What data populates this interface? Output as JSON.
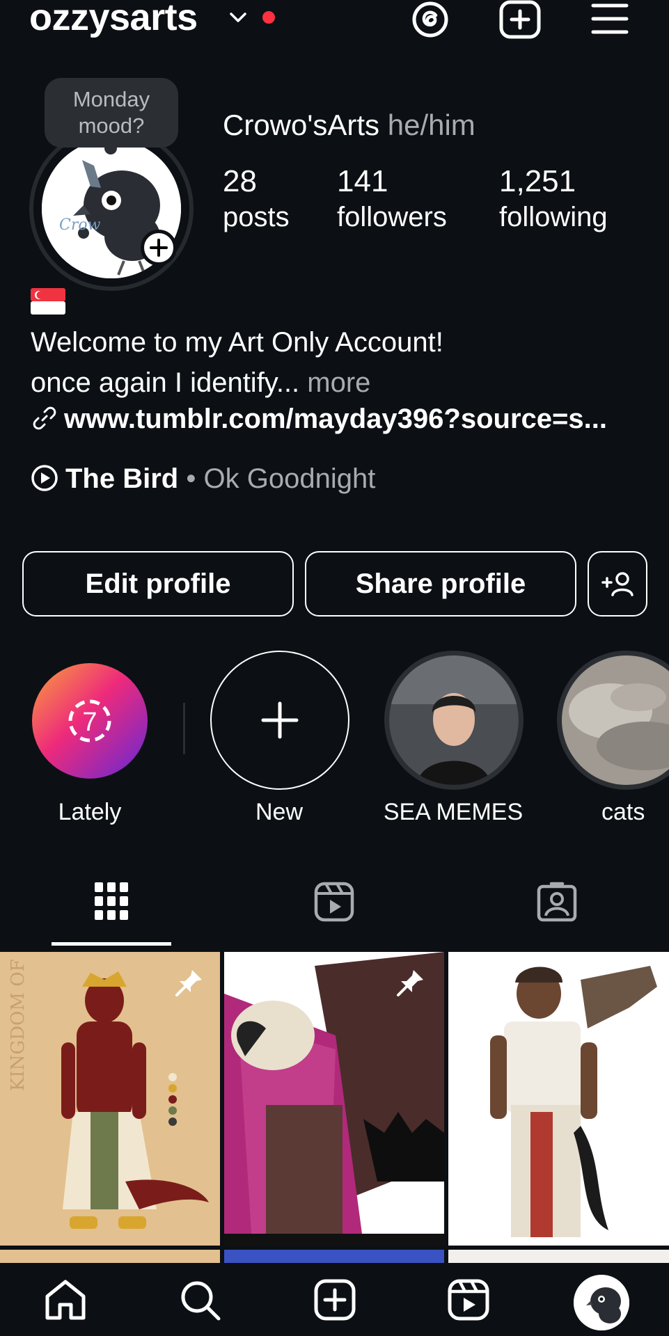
{
  "header": {
    "username": "ozzysarts",
    "has_notification_dot": true
  },
  "note": {
    "text_line1": "Monday",
    "text_line2": "mood?"
  },
  "profile": {
    "display_name": "Crowo'sArts",
    "pronouns": "he/him",
    "avatar_text": "Crow",
    "stats": [
      {
        "number": "28",
        "label": "posts"
      },
      {
        "number": "141",
        "label": "followers"
      },
      {
        "number": "1,251",
        "label": "following"
      }
    ]
  },
  "bio": {
    "flag": "singapore-flag",
    "line1": "Welcome to my Art Only Account!",
    "line2": "once again I identify...",
    "more": "more",
    "link": "www.tumblr.com/mayday396?source=s..."
  },
  "music": {
    "title": "The Bird",
    "separator": "•",
    "artist": "Ok Goodnight"
  },
  "buttons": {
    "edit_profile": "Edit profile",
    "share_profile": "Share profile"
  },
  "highlights": [
    {
      "label": "Lately",
      "badge": "7"
    },
    {
      "label": "New"
    },
    {
      "label": "SEA MEMES"
    },
    {
      "label": "cats"
    }
  ],
  "grid_posts": [
    {
      "pinned": true,
      "caption": "KINGDOM OF SINGAPURA"
    },
    {
      "pinned": true
    },
    {
      "pinned": false
    }
  ],
  "tabs": [
    "grid-icon",
    "reels-icon",
    "tagged-icon"
  ],
  "bottom_nav": [
    "home-icon",
    "search-icon",
    "create-icon",
    "reels-icon",
    "profile-avatar"
  ],
  "colors": {
    "background": "#0c1014",
    "text": "#ffffff",
    "secondary_text": "#a8acb0",
    "notification": "#ff3040"
  }
}
